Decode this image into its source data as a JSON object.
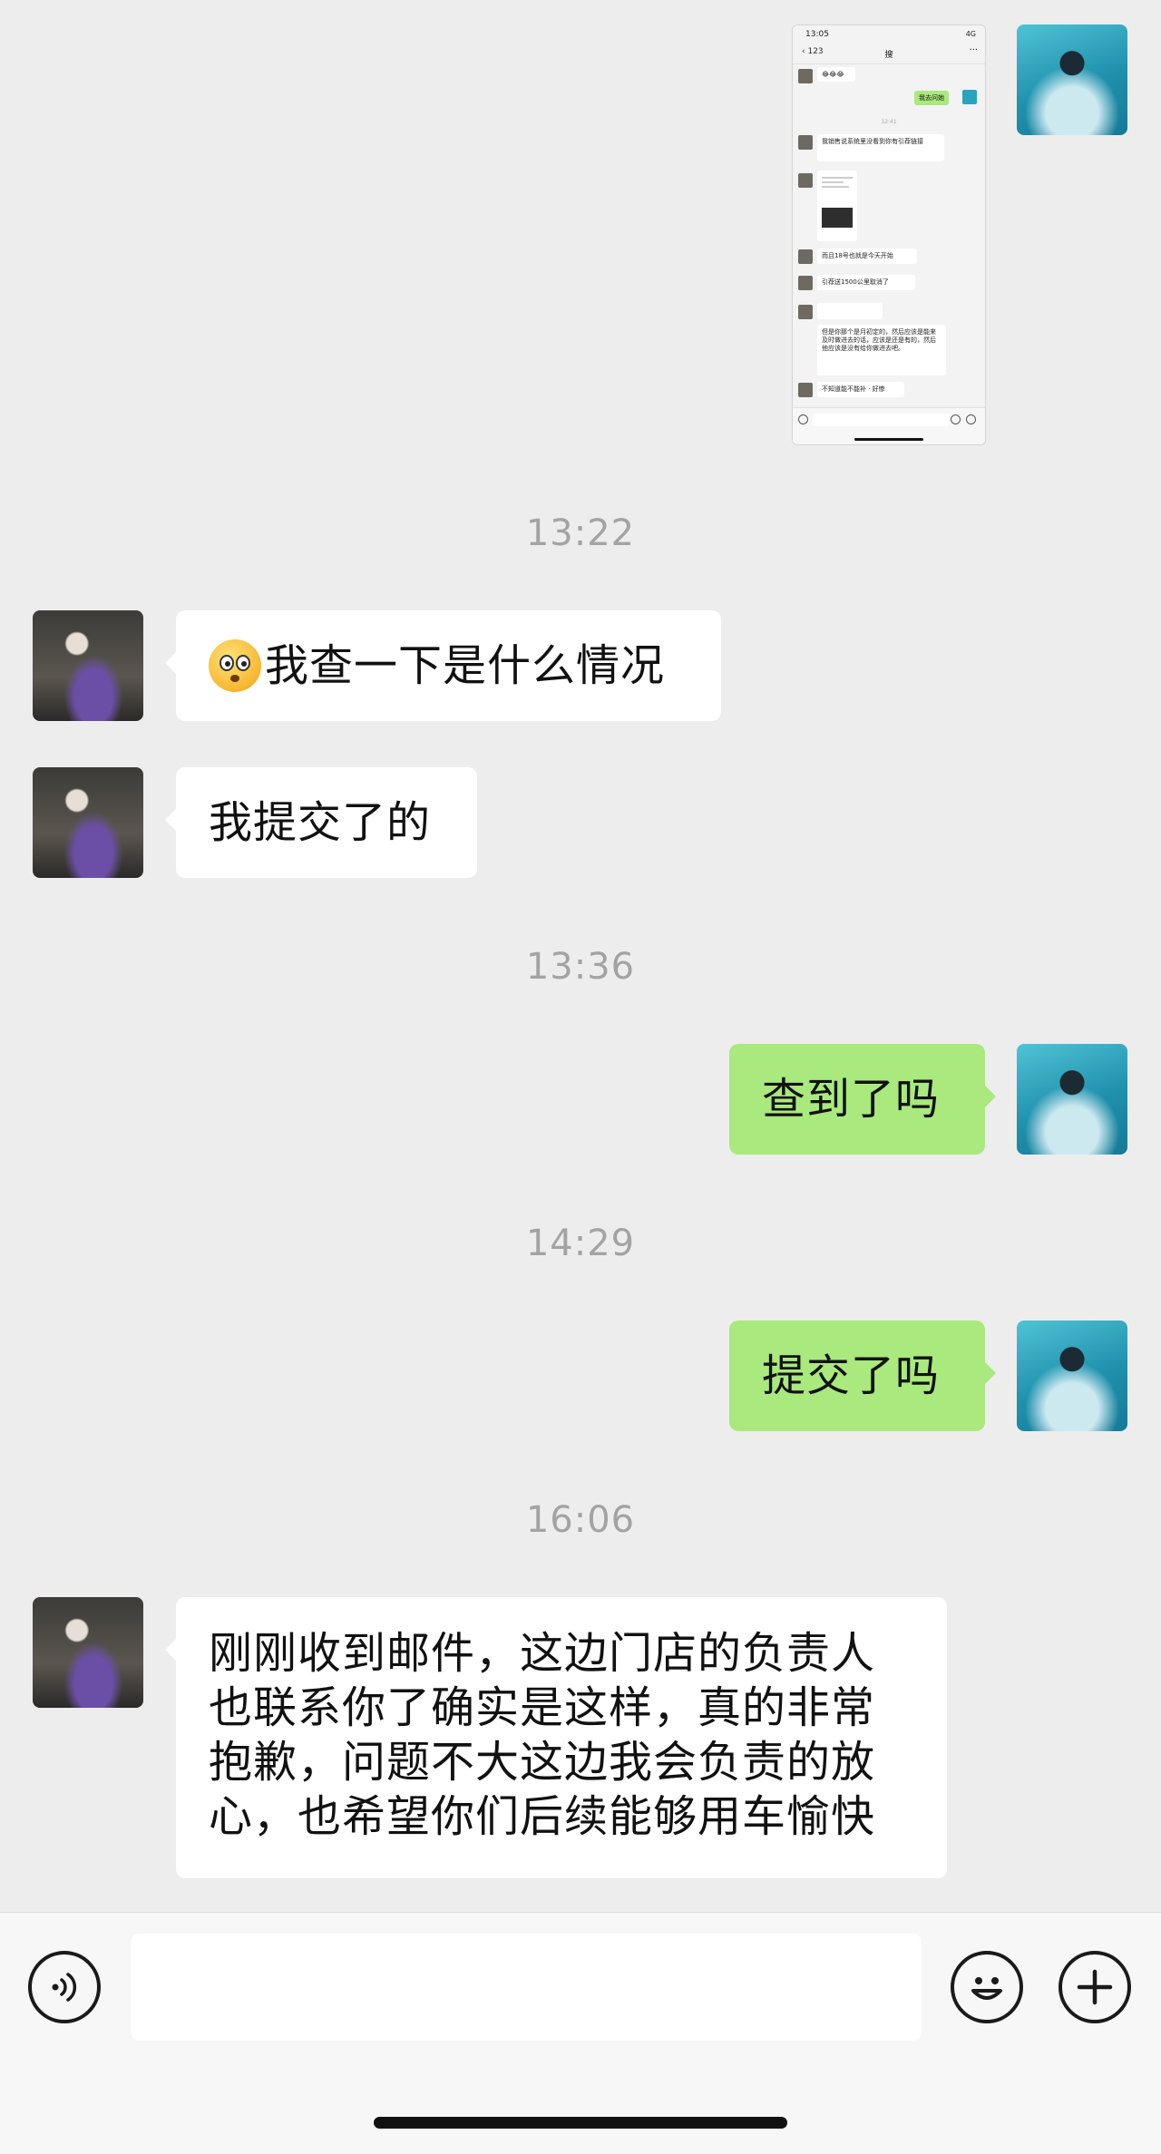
{
  "thumbnail": {
    "status_time": "13:05",
    "status_right": "4G",
    "back_label": "123",
    "title": "搜",
    "more": "···",
    "messages": [
      {
        "side": "in",
        "text": "😂😂😂"
      },
      {
        "side": "out",
        "text": "我去问她"
      },
      {
        "side": "time",
        "text": "12:41"
      },
      {
        "side": "in",
        "text": "我销售说系统里没看到你有引荐链接"
      },
      {
        "side": "in",
        "text": ""
      },
      {
        "side": "in",
        "text": "而且18号也就是今天开始"
      },
      {
        "side": "in",
        "text": "引荐送1500公里取消了"
      },
      {
        "side": "in",
        "text": ""
      },
      {
        "side": "in",
        "text": "但是你那个是月初定的，然后应该是能来及时做进去的话，应该是还是有的，然后他应该是没有给你做进去吧。"
      },
      {
        "side": "in",
        "text": "不知道能不能补 · 好惨"
      }
    ]
  },
  "messages": {
    "time1": "13:22",
    "msg1": "我查一下是什么情况",
    "msg2": "我提交了的",
    "time2": "13:36",
    "msg3": "查到了吗",
    "time3": "14:29",
    "msg4": "提交了吗",
    "time4": "16:06",
    "msg5": "刚刚收到邮件，这边门店的负责人也联系你了确实是这样，真的非常抱歉，问题不大这边我会负责的放心，也希望你们后续能够用车愉快"
  },
  "input": {
    "value": "",
    "icons": [
      "voice-icon",
      "emoji-icon",
      "plus-icon"
    ]
  },
  "colors": {
    "background": "#ededed",
    "outgoing_bubble": "#a9e97d",
    "incoming_bubble": "#ffffff",
    "timestamp": "#a3a3a3"
  }
}
